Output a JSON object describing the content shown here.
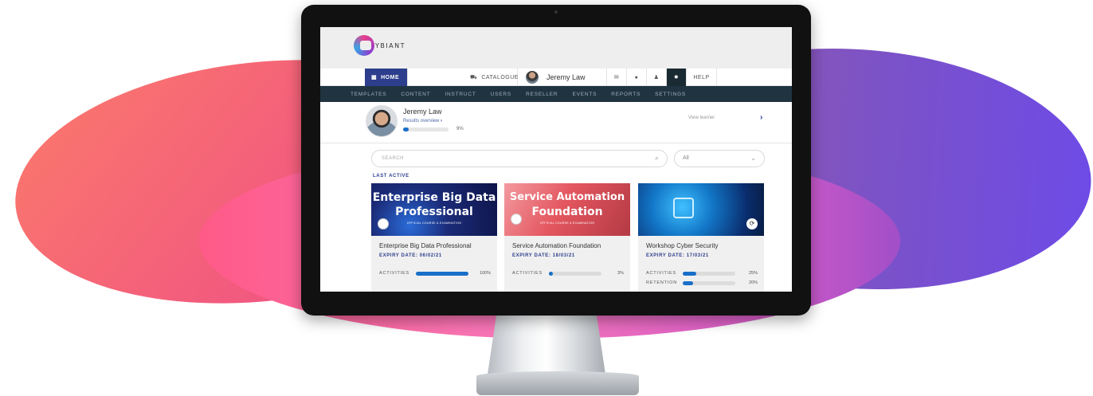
{
  "brand": {
    "logo_text": "CYBIANT"
  },
  "main_nav": {
    "home": "HOME",
    "catalogue": "CATALOGUE",
    "user_name": "Jeremy Law",
    "help": "HELP"
  },
  "admin_nav": [
    "TEMPLATES",
    "CONTENT",
    "INSTRUCT",
    "USERS",
    "RESELLER",
    "EVENTS",
    "REPORTS",
    "SETTINGS"
  ],
  "learner": {
    "name": "Jeremy Law",
    "results_link": "Results overview",
    "progress_pct": 9,
    "progress_label": "9%",
    "view_link": "View learner"
  },
  "search": {
    "placeholder": "SEARCH"
  },
  "filter": {
    "value": "All"
  },
  "section": {
    "title": "LAST ACTIVE"
  },
  "cards": [
    {
      "image_title_line1": "Enterprise Big Data",
      "image_title_line2": "Professional",
      "image_sub": "OFFICIAL COURSE & EXAMINATION",
      "title": "Enterprise Big Data Professional",
      "expiry": "EXPIRY DATE: 06/02/21",
      "stats": [
        {
          "label": "ACTIVITIES",
          "value": 100,
          "pct": "100%"
        }
      ]
    },
    {
      "image_title_line1": "Service Automation",
      "image_title_line2": "Foundation",
      "image_sub": "OFFICIAL COURSE & EXAMINATION",
      "title": "Service Automation Foundation",
      "expiry": "EXPIRY DATE: 18/03/21",
      "stats": [
        {
          "label": "ACTIVITIES",
          "value": 3,
          "pct": "3%"
        }
      ]
    },
    {
      "title": "Workshop Cyber Security",
      "expiry": "EXPIRY DATE: 17/03/21",
      "stats": [
        {
          "label": "ACTIVITIES",
          "value": 25,
          "pct": "25%"
        },
        {
          "label": "RETENTION",
          "value": 20,
          "pct": "20%"
        }
      ]
    }
  ],
  "icons": [
    "home-grid-icon",
    "cart-icon",
    "mail-icon",
    "chat-icon",
    "bell-icon",
    "gear-icon",
    "search-icon",
    "chevron-down-icon",
    "chevron-right-icon",
    "lock-icon",
    "refresh-icon"
  ]
}
